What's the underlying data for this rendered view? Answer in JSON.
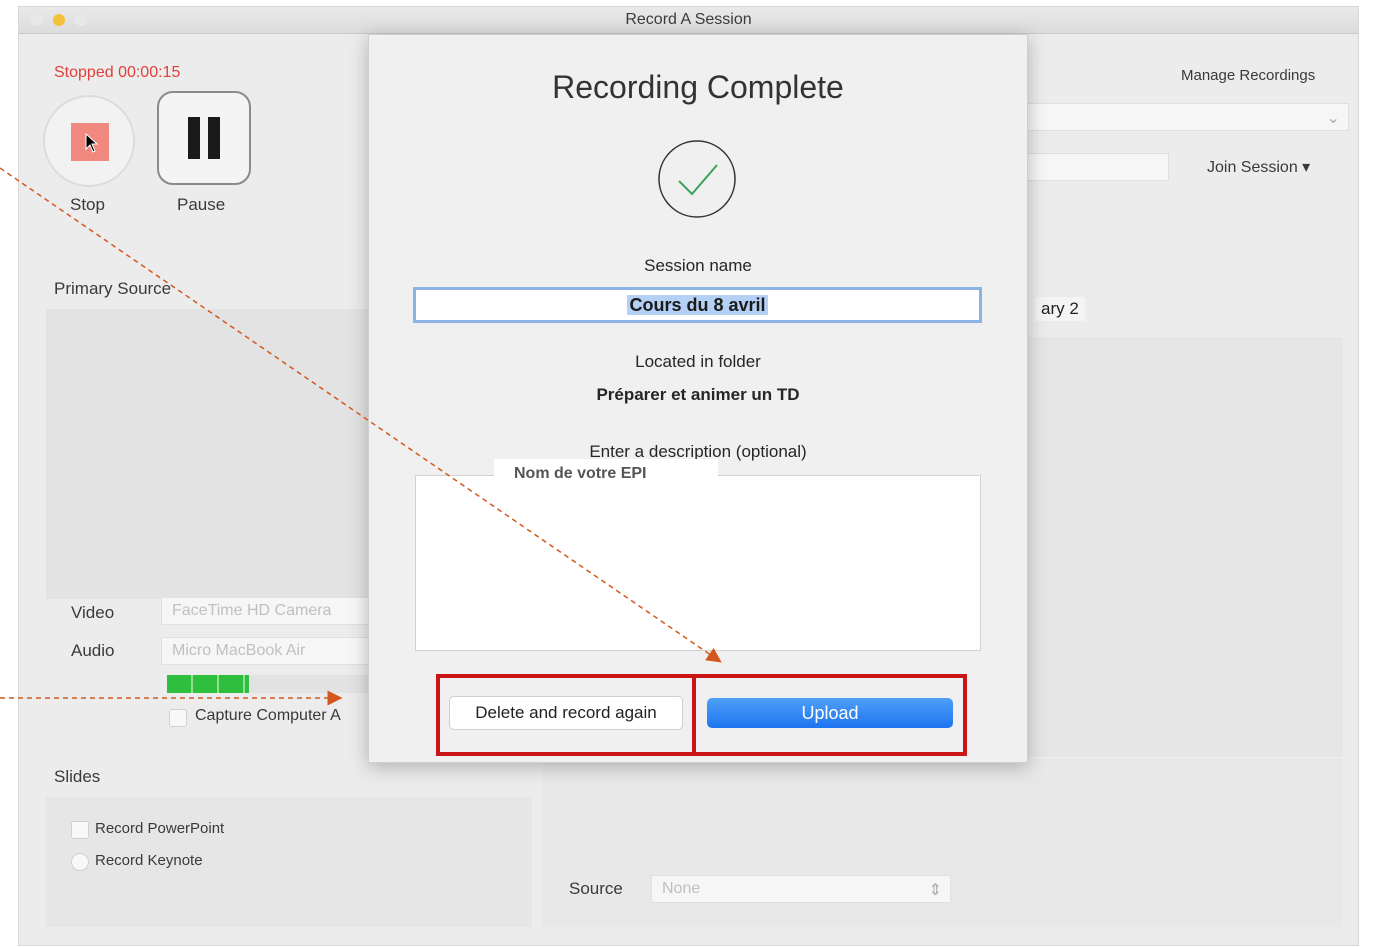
{
  "window": {
    "title": "Record A Session"
  },
  "recorder": {
    "status": "Stopped",
    "time": "00:00:15",
    "stop_label": "Stop",
    "pause_label": "Pause"
  },
  "right_header": {
    "manage_label": "Manage Recordings",
    "join_label": "Join Session",
    "secondary_tab": "ary 2"
  },
  "primary_source": {
    "heading": "Primary Source",
    "video_label": "Video",
    "video_value": "FaceTime HD Camera",
    "audio_label": "Audio",
    "audio_value": "Micro MacBook Air",
    "audio_level": 0.4,
    "capture_label": "Capture Computer A"
  },
  "slides": {
    "heading": "Slides",
    "powerpoint_label": "Record PowerPoint",
    "keynote_label": "Record Keynote"
  },
  "secondary": {
    "source_label": "Source",
    "source_value": "None"
  },
  "dialog": {
    "title": "Recording Complete",
    "session_name_label": "Session name",
    "session_name_value": "Cours du 8 avril",
    "folder_label": "Located in folder",
    "folder_value": "Préparer et animer un TD",
    "description_label": "Enter a description (optional)",
    "delete_label": "Delete and record again",
    "upload_label": "Upload"
  },
  "annotation": {
    "label": "Nom de votre EPI",
    "color": "#c91515",
    "arrow_color": "#d4581e"
  }
}
